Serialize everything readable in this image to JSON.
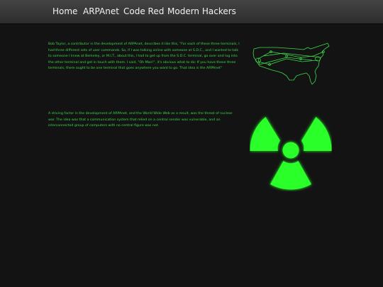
{
  "nav": {
    "items": [
      {
        "label": "Home"
      },
      {
        "label": "ARPAnet"
      },
      {
        "label": "Code Red"
      },
      {
        "label": "Modern Hackers"
      }
    ]
  },
  "content": {
    "paragraph_1": "Bob Taylor, a contributor in the development of ARPAnet, describes it like this, \"For each of these three terminals, I had three different sets of user commands. So, if I was talking online with someone at S.D.C., and I wanted to talk to someone I knew at Berkeley, or M.I.T., about this, I had to get up from the S.D.C. terminal, go over and log into the other terminal and get in touch with them. I said, \"Oh Man!\", it's obvious what to do: If you have these three terminals, there ought to be one terminal that goes anywhere you want to go. That idea is the ARPAnet\"",
    "paragraph_2": "A driving factor in the development of ARPAnet, and the World Wide Web as a result, was the threat of nuclear war. The idea was that a communication system that relied on a central sender was vulnerable, and an interconnected group of computers with no central figure was not."
  },
  "colors": {
    "background": "#131313",
    "navbar": "#3a3a3a",
    "nav_text": "#f2f2f2",
    "terminal_green": "#3bd94a",
    "hazard_green": "#2bff2b"
  },
  "icons": {
    "map": "us-network-map-icon",
    "hazard": "radiation-hazard-icon"
  }
}
